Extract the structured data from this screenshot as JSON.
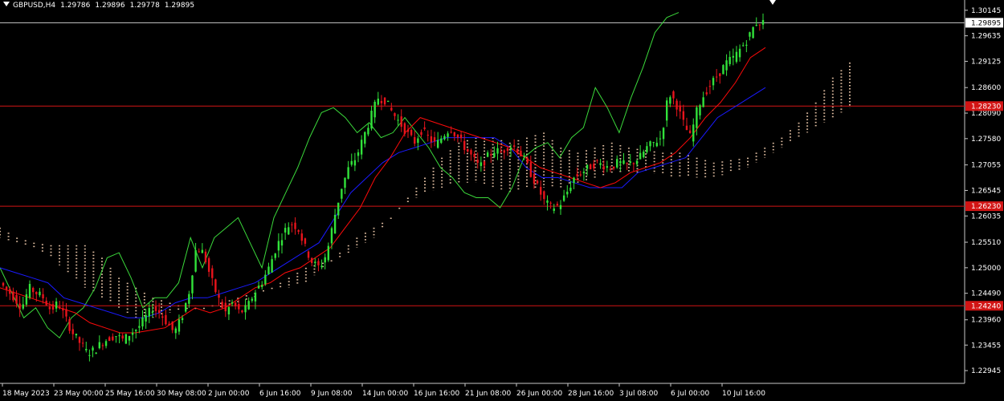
{
  "header": {
    "symbol": "GBPUSD,H4",
    "open": "1.29786",
    "high": "1.29896",
    "low": "1.29778",
    "close": "1.29895"
  },
  "colors": {
    "background": "#000000",
    "bull_candle": "#31e23a",
    "bear_candle": "#e8141c",
    "tenkan": "#ff0a0a",
    "kijun": "#1a1aff",
    "chikou": "#3bd93b",
    "kumo": "#e9c6a8",
    "level_line": "#d21414",
    "bid_line": "#c8c8c8",
    "axis": "#c8c8c8"
  },
  "chart_data": {
    "type": "candlestick",
    "instrument": "GBPUSD",
    "timeframe": "H4",
    "ylim": [
      1.2269,
      1.3035
    ],
    "y_ticks": [
      "1.30145",
      "1.29635",
      "1.29125",
      "1.28600",
      "1.28090",
      "1.27580",
      "1.27055",
      "1.26545",
      "1.26035",
      "1.25510",
      "1.25000",
      "1.24490",
      "1.23960",
      "1.23455",
      "1.22945"
    ],
    "x_ticks": [
      "18 May 2023",
      "23 May 00:00",
      "25 May 16:00",
      "30 May 08:00",
      "2 Jun 00:00",
      "6 Jun 16:00",
      "9 Jun 08:00",
      "14 Jun 00:00",
      "16 Jun 16:00",
      "21 Jun 08:00",
      "26 Jun 00:00",
      "28 Jun 16:00",
      "3 Jul 08:00",
      "6 Jul 00:00",
      "10 Jul 16:00"
    ],
    "bid": {
      "label": "1.29895",
      "value": 1.29895
    },
    "levels": [
      {
        "label": "1.28230",
        "value": 1.2823
      },
      {
        "label": "1.26230",
        "value": 1.2623
      },
      {
        "label": "1.24240",
        "value": 1.2424
      }
    ],
    "price_path": [
      1.247,
      1.2455,
      1.244,
      1.242,
      1.246,
      1.245,
      1.244,
      1.2415,
      1.243,
      1.24,
      1.237,
      1.235,
      1.233,
      1.2335,
      1.235,
      1.236,
      1.2365,
      1.2355,
      1.237,
      1.238,
      1.24,
      1.242,
      1.241,
      1.239,
      1.237,
      1.24,
      1.245,
      1.254,
      1.253,
      1.248,
      1.244,
      1.241,
      1.243,
      1.241,
      1.242,
      1.245,
      1.247,
      1.25,
      1.254,
      1.257,
      1.259,
      1.258,
      1.254,
      1.251,
      1.25,
      1.253,
      1.26,
      1.266,
      1.27,
      1.272,
      1.276,
      1.28,
      1.284,
      1.2835,
      1.281,
      1.279,
      1.277,
      1.275,
      1.2775,
      1.276,
      1.2745,
      1.2765,
      1.278,
      1.276,
      1.274,
      1.272,
      1.27,
      1.272,
      1.2735,
      1.273,
      1.2745,
      1.274,
      1.272,
      1.269,
      1.266,
      1.263,
      1.262,
      1.2625,
      1.265,
      1.268,
      1.269,
      1.27,
      1.271,
      1.2705,
      1.27,
      1.271,
      1.2705,
      1.271,
      1.272,
      1.274,
      1.275,
      1.276,
      1.285,
      1.283,
      1.279,
      1.276,
      1.282,
      1.285,
      1.287,
      1.289,
      1.291,
      1.292,
      1.294,
      1.296,
      1.299,
      1.29895
    ],
    "tenkan_path": [
      1.246,
      1.245,
      1.244,
      1.243,
      1.242,
      1.241,
      1.239,
      1.238,
      1.237,
      1.237,
      1.2375,
      1.238,
      1.24,
      1.242,
      1.241,
      1.242,
      1.244,
      1.246,
      1.247,
      1.249,
      1.25,
      1.252,
      1.254,
      1.258,
      1.262,
      1.268,
      1.272,
      1.277,
      1.28,
      1.279,
      1.278,
      1.277,
      1.276,
      1.275,
      1.274,
      1.272,
      1.27,
      1.269,
      1.268,
      1.267,
      1.266,
      1.267,
      1.269,
      1.27,
      1.271,
      1.273,
      1.276,
      1.28,
      1.283,
      1.287,
      1.292,
      1.294
    ],
    "kijun_path": [
      1.25,
      1.249,
      1.248,
      1.247,
      1.244,
      1.243,
      1.242,
      1.241,
      1.24,
      1.24,
      1.241,
      1.243,
      1.244,
      1.244,
      1.245,
      1.246,
      1.247,
      1.249,
      1.251,
      1.253,
      1.255,
      1.26,
      1.265,
      1.268,
      1.271,
      1.273,
      1.274,
      1.275,
      1.276,
      1.276,
      1.276,
      1.276,
      1.274,
      1.27,
      1.268,
      1.268,
      1.267,
      1.266,
      1.266,
      1.266,
      1.269,
      1.27,
      1.271,
      1.272,
      1.276,
      1.28,
      1.282,
      1.284,
      1.286
    ],
    "chikou_path": [
      1.25,
      1.245,
      1.24,
      1.242,
      1.238,
      1.236,
      1.24,
      1.242,
      1.246,
      1.252,
      1.253,
      1.248,
      1.242,
      1.244,
      1.244,
      1.247,
      1.256,
      1.25,
      1.256,
      1.258,
      1.26,
      1.255,
      1.25,
      1.26,
      1.265,
      1.27,
      1.276,
      1.281,
      1.282,
      1.28,
      1.277,
      1.279,
      1.276,
      1.277,
      1.28,
      1.277,
      1.274,
      1.27,
      1.268,
      1.265,
      1.264,
      1.264,
      1.262,
      1.266,
      1.272,
      1.274,
      1.275,
      1.272,
      1.276,
      1.278,
      1.286,
      1.282,
      1.277,
      1.284,
      1.29,
      1.297,
      1.3,
      1.301
    ],
    "kumo_upper": [
      1.258,
      1.256,
      1.255,
      1.2545,
      1.2545,
      1.2545,
      1.252,
      1.248,
      1.246,
      1.244,
      1.243,
      1.242,
      1.242,
      1.243,
      1.244,
      1.245,
      1.246,
      1.246,
      1.247,
      1.25,
      1.253,
      1.256,
      1.258,
      1.26,
      1.264,
      1.268,
      1.272,
      1.275,
      1.276,
      1.276,
      1.275,
      1.276,
      1.277,
      1.274,
      1.273,
      1.274,
      1.275,
      1.274,
      1.2735,
      1.273,
      1.273,
      1.272,
      1.271,
      1.2715,
      1.272,
      1.274,
      1.276,
      1.279,
      1.283,
      1.288,
      1.291
    ],
    "kumo_lower": [
      1.256,
      1.255,
      1.254,
      1.252,
      1.249,
      1.246,
      1.244,
      1.242,
      1.24,
      1.24,
      1.241,
      1.242,
      1.242,
      1.242,
      1.243,
      1.244,
      1.246,
      1.248,
      1.25,
      1.251,
      1.252,
      1.254,
      1.256,
      1.26,
      1.263,
      1.265,
      1.266,
      1.267,
      1.267,
      1.266,
      1.265,
      1.266,
      1.266,
      1.266,
      1.267,
      1.268,
      1.269,
      1.269,
      1.269,
      1.2685,
      1.268,
      1.268,
      1.268,
      1.269,
      1.27,
      1.272,
      1.274,
      1.276,
      1.278,
      1.28,
      1.282
    ]
  }
}
